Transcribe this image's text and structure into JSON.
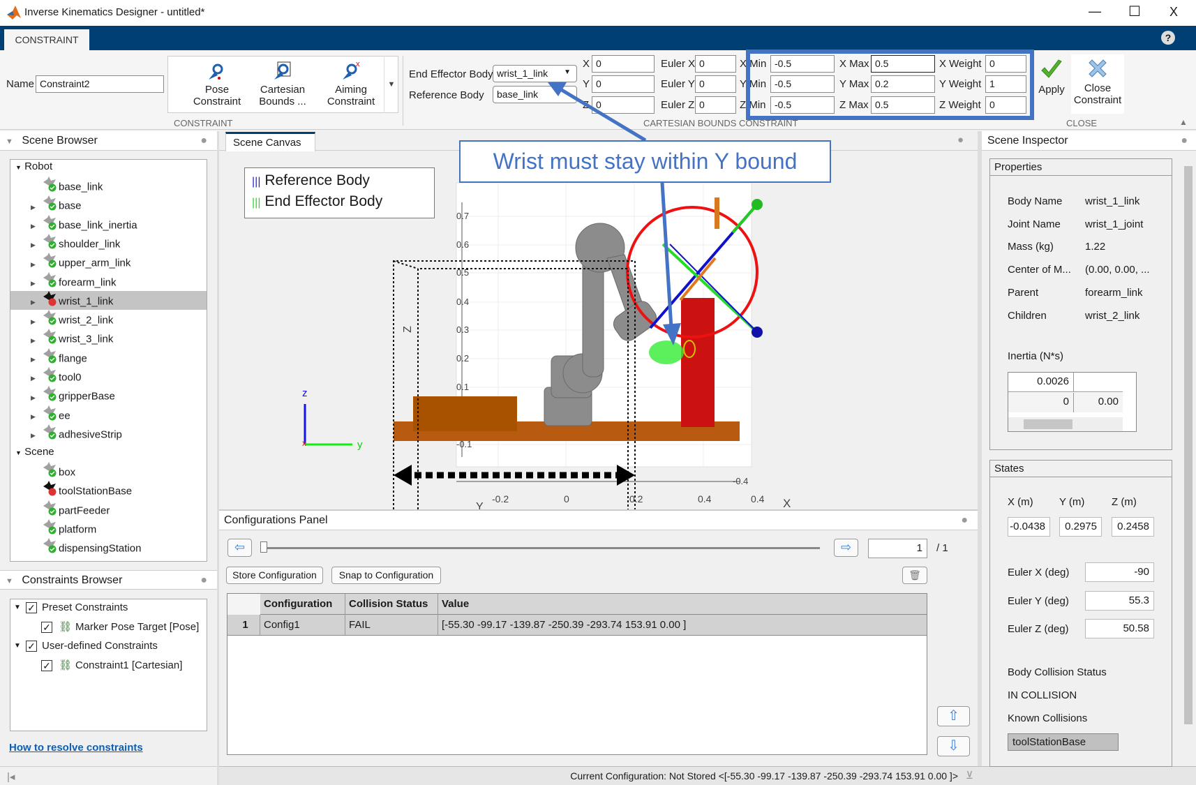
{
  "window": {
    "title": "Inverse Kinematics Designer - untitled*",
    "minimize": "—",
    "maximize": "☐",
    "close": "X"
  },
  "ribbon": {
    "tab": "CONSTRAINT",
    "help": "?",
    "name_label": "Name",
    "name_value": "Constraint2",
    "gallery": [
      {
        "line1": "Pose",
        "line2": "Constraint"
      },
      {
        "line1": "Cartesian",
        "line2": "Bounds ..."
      },
      {
        "line1": "Aiming",
        "line2": "Constraint"
      }
    ],
    "constraint_section": "CONSTRAINT",
    "ee_label": "End Effector Body",
    "ee_value": "wrist_1_link",
    "ref_label": "Reference Body",
    "ref_value": "base_link",
    "pos": [
      {
        "label": "X",
        "value": "0"
      },
      {
        "label": "Y",
        "value": "0"
      },
      {
        "label": "Z",
        "value": "0"
      }
    ],
    "euler": [
      {
        "label": "Euler X",
        "value": "0"
      },
      {
        "label": "Euler Y",
        "value": "0"
      },
      {
        "label": "Euler Z",
        "value": "0"
      }
    ],
    "bounds": [
      {
        "min_label": "X Min",
        "min": "-0.5",
        "max_label": "X Max",
        "max": "0.5",
        "w_label": "X Weight",
        "w": "0"
      },
      {
        "min_label": "Y Min",
        "min": "-0.5",
        "max_label": "Y Max",
        "max": "0.2",
        "w_label": "Y Weight",
        "w": "1"
      },
      {
        "min_label": "Z Min",
        "min": "-0.5",
        "max_label": "Z Max",
        "max": "0.5",
        "w_label": "Z Weight",
        "w": "0"
      }
    ],
    "bounds_section": "CARTESIAN BOUNDS CONSTRAINT",
    "apply": "Apply",
    "close_l1": "Close",
    "close_l2": "Constraint",
    "close_section": "CLOSE"
  },
  "scene_browser": {
    "title": "Scene Browser",
    "robot_label": "Robot",
    "robot": [
      {
        "label": "base_link",
        "status": "ok",
        "exp": false
      },
      {
        "label": "base",
        "status": "ok",
        "exp": true
      },
      {
        "label": "base_link_inertia",
        "status": "ok",
        "exp": true
      },
      {
        "label": "shoulder_link",
        "status": "ok",
        "exp": true
      },
      {
        "label": "upper_arm_link",
        "status": "ok",
        "exp": true
      },
      {
        "label": "forearm_link",
        "status": "ok",
        "exp": true
      },
      {
        "label": "wrist_1_link",
        "status": "collision",
        "exp": true,
        "selected": true
      },
      {
        "label": "wrist_2_link",
        "status": "ok",
        "exp": true
      },
      {
        "label": "wrist_3_link",
        "status": "ok",
        "exp": true
      },
      {
        "label": "flange",
        "status": "ok",
        "exp": true
      },
      {
        "label": "tool0",
        "status": "ok",
        "exp": true
      },
      {
        "label": "gripperBase",
        "status": "ok",
        "exp": true
      },
      {
        "label": "ee",
        "status": "ok",
        "exp": true
      },
      {
        "label": "adhesiveStrip",
        "status": "ok",
        "exp": true
      }
    ],
    "scene_label": "Scene",
    "scene": [
      {
        "label": "box",
        "status": "ok"
      },
      {
        "label": "toolStationBase",
        "status": "collision"
      },
      {
        "label": "partFeeder",
        "status": "ok"
      },
      {
        "label": "platform",
        "status": "ok"
      },
      {
        "label": "dispensingStation",
        "status": "ok"
      }
    ]
  },
  "constraints_browser": {
    "title": "Constraints Browser",
    "preset": "Preset Constraints",
    "preset_item": "Marker Pose Target [Pose]",
    "user": "User-defined Constraints",
    "user_item": "Constraint1 [Cartesian]",
    "help_link": "How to resolve constraints"
  },
  "canvas": {
    "tab": "Scene Canvas",
    "legend": [
      "Reference  Body",
      "End  Effector  Body"
    ],
    "z_ticks": [
      "0.7",
      "0.6",
      "0.5",
      "0.4",
      "0.3",
      "0.2",
      "0.1",
      "-0.1"
    ],
    "y_ticks": [
      "-0.2",
      "0",
      "0.2",
      "0.4"
    ],
    "x_tick": "0.4",
    "x_tick2": "-0.4",
    "z_axis": "Z",
    "y_axis": "Y",
    "x_axis": "X",
    "triad": {
      "z": "z",
      "y": "y",
      "x": "x"
    },
    "callout": "Wrist must stay within Y bound"
  },
  "config_panel": {
    "title": "Configurations Panel",
    "page": "1",
    "page_total": "/ 1",
    "store": "Store Configuration",
    "snap": "Snap to Configuration",
    "columns": [
      "Configuration",
      "Collision Status",
      "Value"
    ],
    "rows": [
      {
        "n": "1",
        "config": "Config1",
        "status": "FAIL",
        "value": "[-55.30 -99.17 -139.87 -250.39 -293.74 153.91 0.00 ]"
      }
    ],
    "slider_fraction": 0
  },
  "status_bar": "Current Configuration: Not Stored <[-55.30 -99.17 -139.87 -250.39 -293.74 153.91 0.00 ]>",
  "inspector": {
    "title": "Scene Inspector",
    "properties": "Properties",
    "props": [
      {
        "k": "Body Name",
        "v": "wrist_1_link"
      },
      {
        "k": "Joint Name",
        "v": "wrist_1_joint"
      },
      {
        "k": "Mass (kg)",
        "v": "1.22"
      },
      {
        "k": "Center of M...",
        "v": "(0.00, 0.00, ..."
      },
      {
        "k": "Parent",
        "v": "forearm_link"
      },
      {
        "k": "Children",
        "v": "wrist_2_link"
      }
    ],
    "inertia_label": "Inertia (N*s)",
    "inertia": [
      [
        "0.0026",
        ""
      ],
      [
        "0",
        "0.00"
      ]
    ],
    "states": "States",
    "xyz_labels": [
      "X (m)",
      "Y (m)",
      "Z (m)"
    ],
    "xyz": [
      "-0.0438",
      "0.2975",
      "0.2458"
    ],
    "euler": [
      {
        "k": "Euler X (deg)",
        "v": "-90"
      },
      {
        "k": "Euler Y (deg)",
        "v": "55.3"
      },
      {
        "k": "Euler Z (deg)",
        "v": "50.58"
      }
    ],
    "collision_label": "Body Collision Status",
    "collision": "IN COLLISION",
    "known_label": "Known Collisions",
    "known": "toolStationBase"
  },
  "colors": {
    "accent": "#003f73",
    "callout": "#4472c4"
  }
}
